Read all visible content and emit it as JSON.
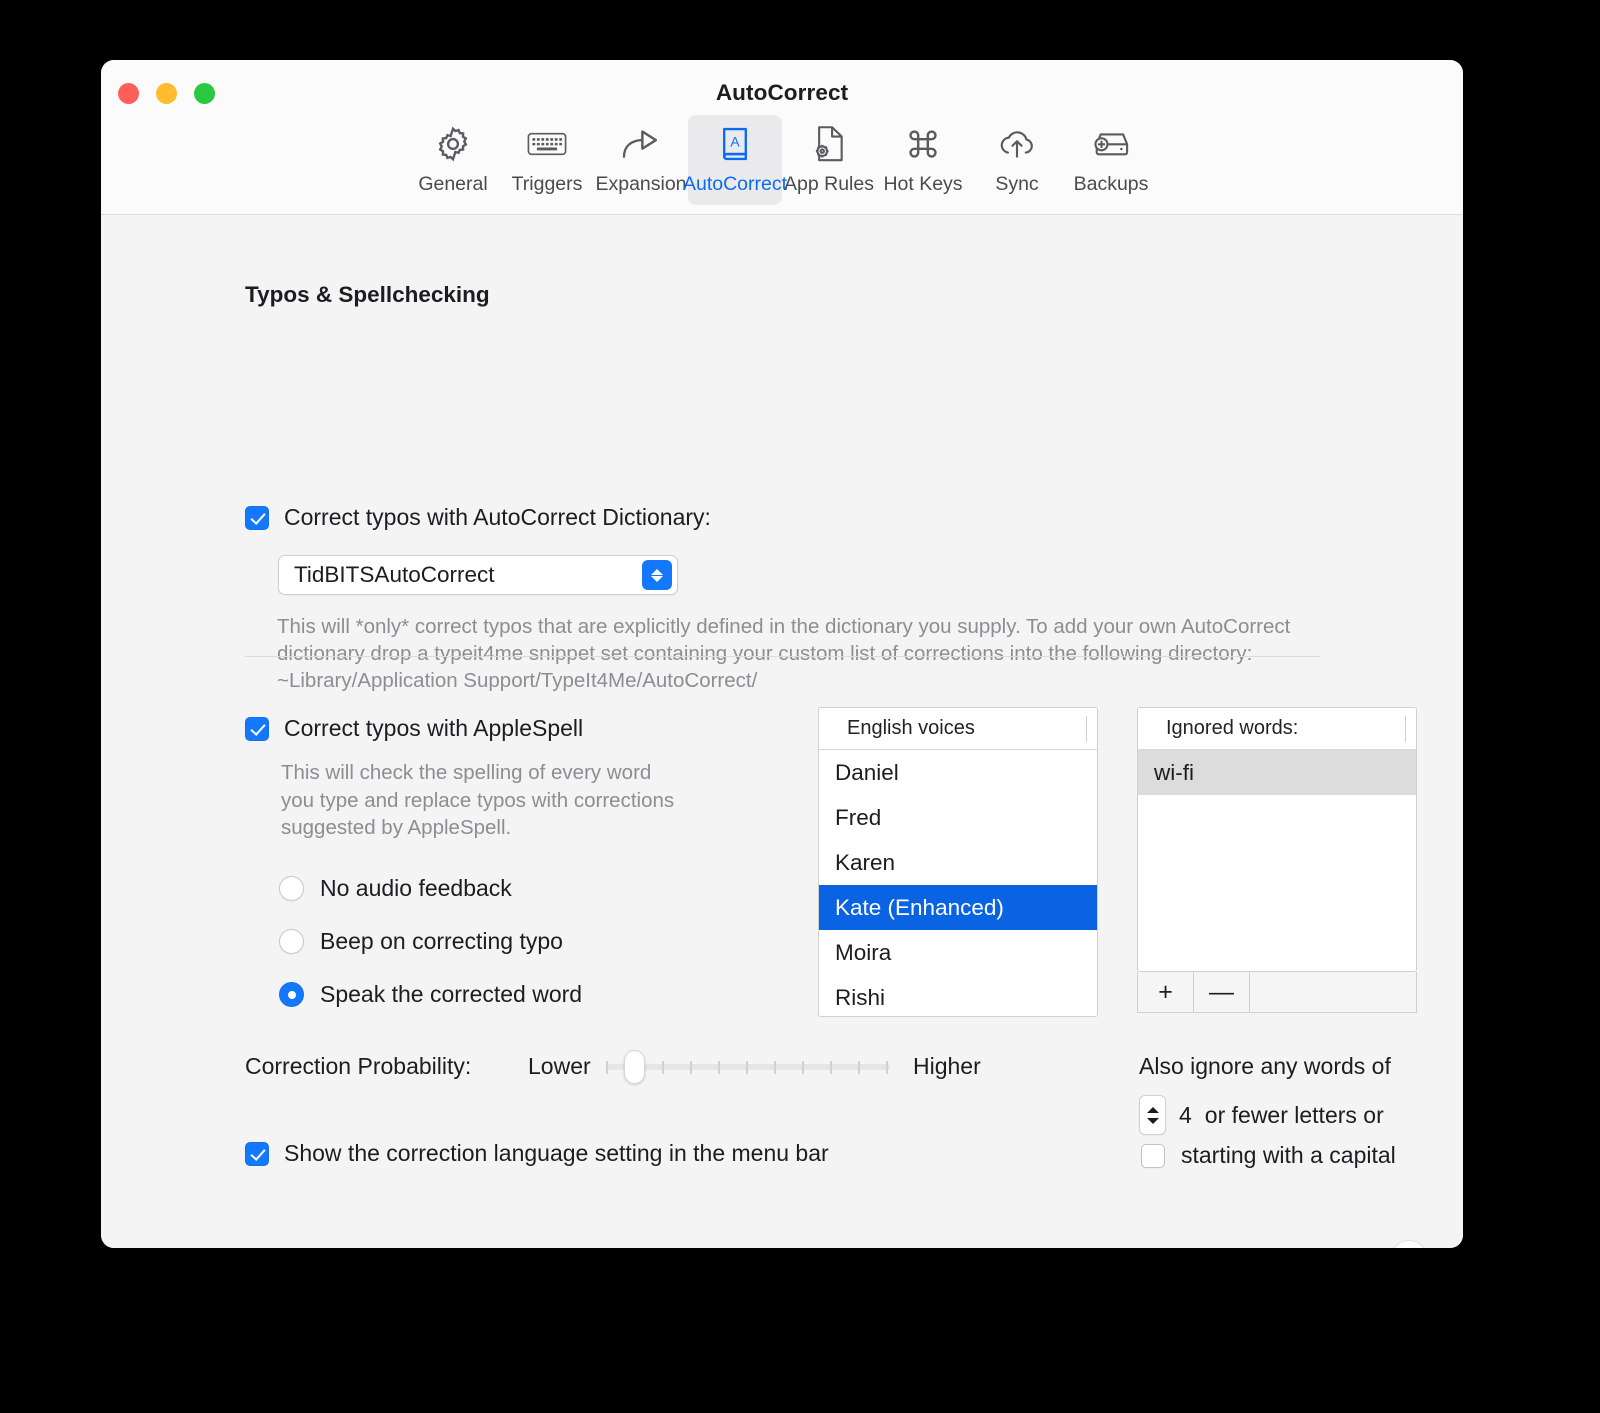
{
  "window": {
    "title": "AutoCorrect",
    "traffic_lights": [
      "close-red",
      "minimize-yellow",
      "zoom-green"
    ]
  },
  "toolbar": {
    "tabs": [
      {
        "label": "General",
        "icon": "gear-icon",
        "active": false
      },
      {
        "label": "Triggers",
        "icon": "keyboard-icon",
        "active": false
      },
      {
        "label": "Expansion",
        "icon": "share-arrow-icon",
        "active": false
      },
      {
        "label": "AutoCorrect",
        "icon": "book-a-icon",
        "active": true
      },
      {
        "label": "App Rules",
        "icon": "document-gear-icon",
        "active": false
      },
      {
        "label": "Hot Keys",
        "icon": "command-key-icon",
        "active": false
      },
      {
        "label": "Sync",
        "icon": "cloud-upload-icon",
        "active": false
      },
      {
        "label": "Backups",
        "icon": "drive-plus-icon",
        "active": false
      }
    ],
    "active_color": "#0a6cf1"
  },
  "main": {
    "section_title": "Typos & Spellchecking",
    "dictionary": {
      "checkbox_label": "Correct typos with AutoCorrect Dictionary:",
      "checked": true,
      "selected_value": "TidBITSAutoCorrect",
      "help_text": "This will *only* correct typos that are explicitly defined in the dictionary you supply. To add your own AutoCorrect dictionary drop a typeit4me snippet set containing your custom list of corrections into the following directory:  ~Library/Application Support/TypeIt4Me/AutoCorrect/"
    },
    "applespell": {
      "checkbox_label": "Correct typos with AppleSpell",
      "checked": true,
      "help_text": "This will check the spelling of every word you type and replace typos with corrections suggested by AppleSpell.",
      "audio_options": [
        {
          "label": "No audio feedback",
          "selected": false
        },
        {
          "label": "Beep on correcting typo",
          "selected": false
        },
        {
          "label": "Speak the corrected word",
          "selected": true
        }
      ]
    },
    "voices_list": {
      "header": "English voices",
      "items": [
        "Daniel",
        "Fred",
        "Karen",
        "Kate (Enhanced)",
        "Moira",
        "Rishi"
      ],
      "selected": "Kate (Enhanced)",
      "selection_color": "#0a63e3"
    },
    "ignored_words": {
      "header": "Ignored words:",
      "items": [
        "wi-fi"
      ],
      "selected": "wi-fi",
      "selection_color": "#dcdcdc",
      "add_label": "+",
      "remove_label": "—"
    },
    "correction_probability": {
      "label": "Correction Probability:",
      "low_label": "Lower",
      "high_label": "Higher",
      "ticks": 11,
      "value_index": 1
    },
    "menubar_option": {
      "label": "Show the correction language setting in the menu bar",
      "checked": true
    },
    "ignore_options": {
      "intro": "Also ignore any words of",
      "letters_value": "4",
      "letters_suffix": "or fewer letters or",
      "capital_label": "starting with a capital",
      "capital_checked": false
    },
    "help_button": "?"
  }
}
